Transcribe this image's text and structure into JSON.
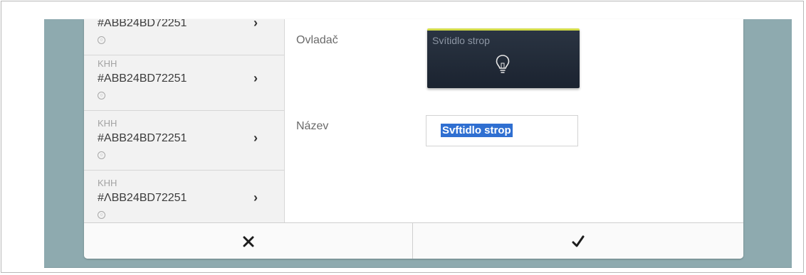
{
  "list": {
    "items": [
      {
        "type": "",
        "id": "#ABB24BD72251",
        "chevron": "›"
      },
      {
        "type": "KHH",
        "id": "#ABB24BD72251",
        "chevron": "›"
      },
      {
        "type": "KHH",
        "id": "#ABB24BD72251",
        "chevron": "›"
      },
      {
        "type": "KHH",
        "id": "#ΛBB24BD72251",
        "chevron": "›"
      }
    ]
  },
  "form": {
    "controller_label": "Ovladač",
    "controller_tile": {
      "title": "Svítidlo strop",
      "icon": "bulb-icon",
      "accent": "#d3dc4a"
    },
    "name_label": "Název",
    "name_value": "Svftidlo strop",
    "selection_color": "#2f6fd1"
  },
  "footer": {
    "cancel_icon": "close-icon",
    "confirm_icon": "check-icon"
  },
  "colors": {
    "background": "#8eaaaf",
    "tile": "#1b2330"
  }
}
